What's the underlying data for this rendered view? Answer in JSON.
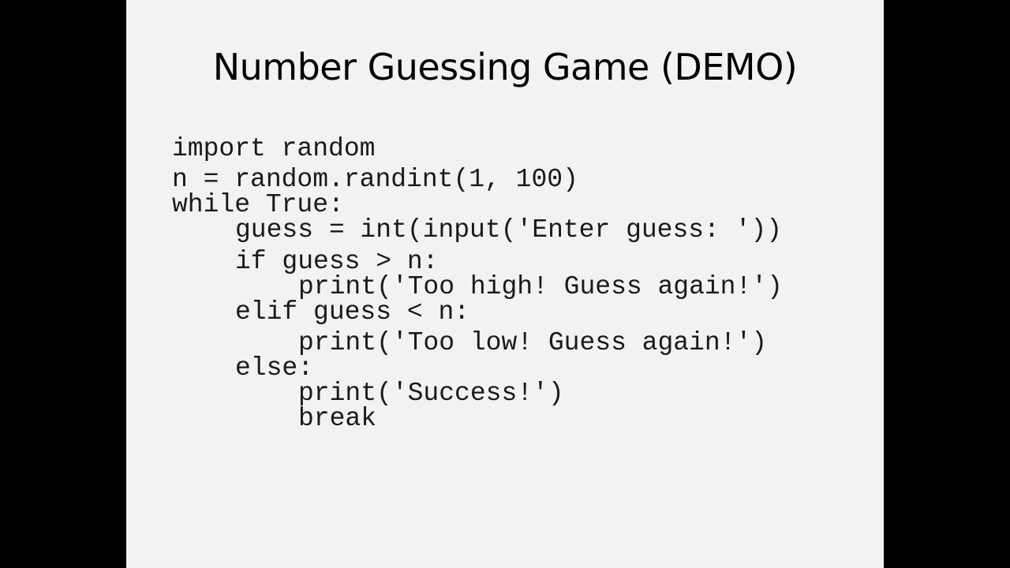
{
  "slide": {
    "title": "Number Guessing Game (DEMO)",
    "code_lines": [
      "import random",
      "n = random.randint(1, 100)",
      "while True:",
      "guess = int(input('Enter guess: '))",
      "if guess > n:",
      "print('Too high! Guess again!')",
      "elif guess < n:",
      "print('Too low! Guess again!')",
      "else:",
      "print('Success!')",
      "break"
    ]
  }
}
